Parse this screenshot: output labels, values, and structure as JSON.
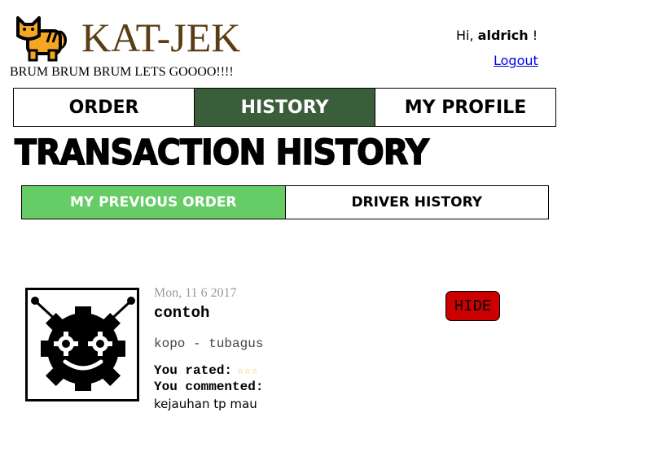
{
  "brand": {
    "title": "KAT-JEK",
    "tagline": "BRUM BRUM BRUM LETS GOOOO!!!!",
    "logo_icon": "cat-icon",
    "title_color": "#5a3d14"
  },
  "user": {
    "greeting_prefix": "Hi,",
    "username": "aldrich",
    "greeting_suffix": "!",
    "logout_label": "Logout"
  },
  "main_nav": {
    "tabs": [
      {
        "label": "ORDER",
        "active": false
      },
      {
        "label": "HISTORY",
        "active": true
      },
      {
        "label": "MY PROFILE",
        "active": false
      }
    ],
    "active_color": "#3b5e3a"
  },
  "page": {
    "title": "TRANSACTION HISTORY"
  },
  "sub_nav": {
    "tabs": [
      {
        "label": "MY PREVIOUS ORDER",
        "active": true
      },
      {
        "label": "DRIVER HISTORY",
        "active": false
      }
    ],
    "active_color": "#66cc66"
  },
  "orders": [
    {
      "avatar_icon": "robot-gear-icon",
      "date": "Mon, 11 6 2017",
      "name": "contoh",
      "route": "kopo - tubagus",
      "rated_label": "You rated:",
      "rating": 3,
      "commented_label": "You commented:",
      "comment": "kejauhan tp mau",
      "hide_label": "HIDE",
      "hide_color": "#cc0000"
    }
  ]
}
